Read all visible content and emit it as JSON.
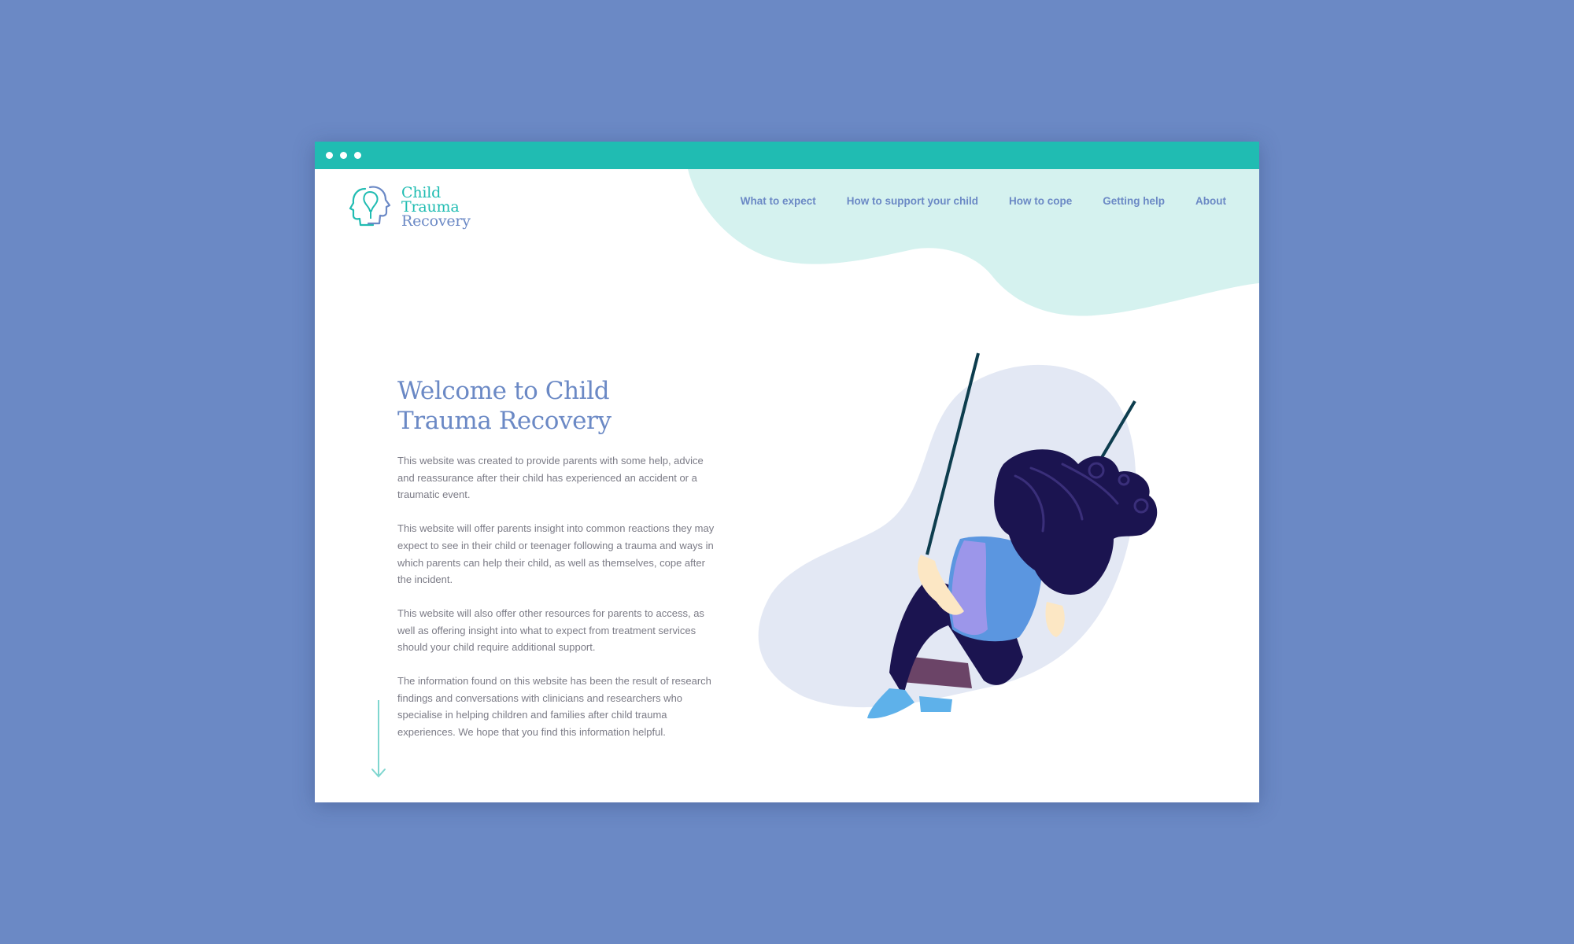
{
  "window": {
    "controls": [
      "dot",
      "dot",
      "dot"
    ]
  },
  "logo": {
    "line1": "Child",
    "line2": "Trauma",
    "line3": "Recovery",
    "icon": "heads-profile-icon"
  },
  "nav": {
    "items": [
      {
        "label": "What to expect"
      },
      {
        "label": "How to support your child"
      },
      {
        "label": "How to cope"
      },
      {
        "label": "Getting help"
      },
      {
        "label": "About"
      }
    ]
  },
  "hero": {
    "title_line1": "Welcome to Child",
    "title_line2": "Trauma Recovery",
    "paragraphs": [
      "This website was created to provide parents with some help, advice and reassurance after their child has experienced an accident or a traumatic event.",
      "This website will offer parents insight into common reactions they may expect to see in their child or teenager following a trauma and ways in which parents can help their child, as well as themselves, cope after the incident.",
      "This website will also offer other resources for parents to access, as well as offering insight into what to expect from treatment services should your child require additional support.",
      "The information found on this website has been the result of research findings and conversations with clinicians and researchers who specialise in helping children and families after child trauma experiences. We hope that you find this information helpful."
    ]
  },
  "scroll": {
    "icon": "arrow-down-icon"
  },
  "illustration": {
    "subject": "girl-on-swing-illustration"
  },
  "colors": {
    "page_background": "#6b89c5",
    "accent_teal": "#20bcb2",
    "blob_mint": "#d5f2ef",
    "blob_lavender": "#e3e8f4",
    "text_blue": "#6b89c5",
    "body_text": "#7b7b86",
    "hair": "#1b1450"
  }
}
